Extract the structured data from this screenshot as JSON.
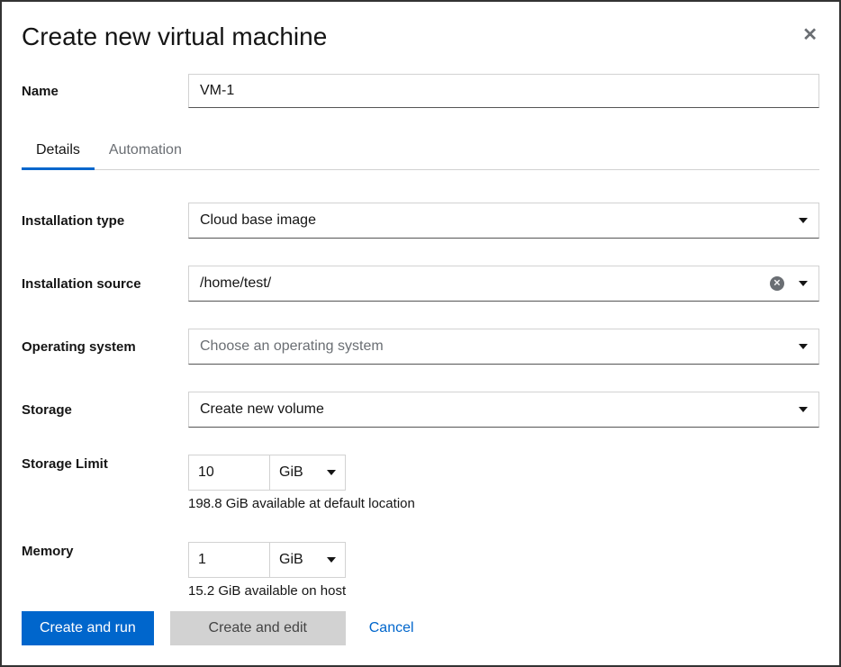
{
  "header": {
    "title": "Create new virtual machine"
  },
  "name": {
    "label": "Name",
    "value": "VM-1"
  },
  "tabs": {
    "details": "Details",
    "automation": "Automation"
  },
  "install_type": {
    "label": "Installation type",
    "value": "Cloud base image"
  },
  "install_source": {
    "label": "Installation source",
    "value": "/home/test/"
  },
  "os": {
    "label": "Operating system",
    "placeholder": "Choose an operating system"
  },
  "storage": {
    "label": "Storage",
    "value": "Create new volume"
  },
  "storage_limit": {
    "label": "Storage Limit",
    "value": "10",
    "unit": "GiB",
    "hint": "198.8 GiB available at default location"
  },
  "memory": {
    "label": "Memory",
    "value": "1",
    "unit": "GiB",
    "hint": "15.2 GiB available on host"
  },
  "footer": {
    "create_run": "Create and run",
    "create_edit": "Create and edit",
    "cancel": "Cancel"
  }
}
